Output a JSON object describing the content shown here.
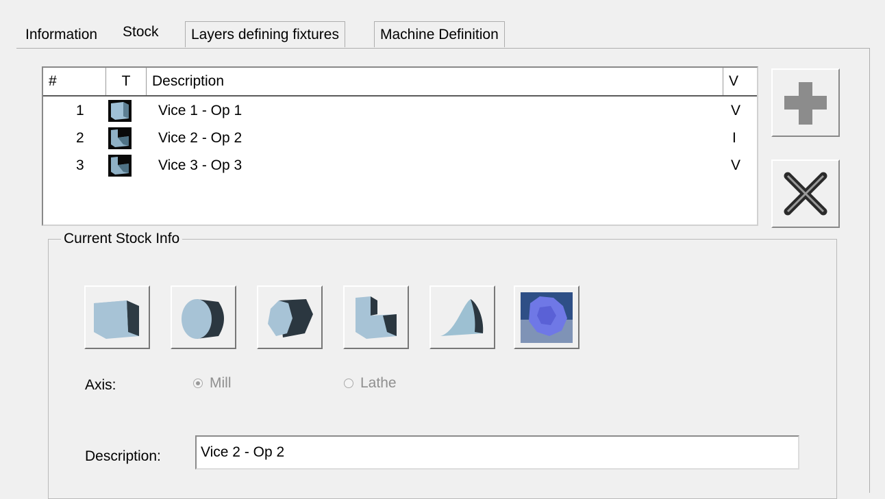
{
  "tabs": [
    {
      "label": "Information"
    },
    {
      "label": "Stock",
      "active": true
    },
    {
      "label": "Layers defining fixtures"
    },
    {
      "label": "Machine Definition"
    }
  ],
  "stock_list": {
    "columns": [
      "#",
      "T",
      "Description",
      "V"
    ],
    "rows": [
      {
        "num": "1",
        "type_icon": "block-stock-icon",
        "description": "Vice 1 - Op 1",
        "v": "V"
      },
      {
        "num": "2",
        "type_icon": "extrusion-stock-icon",
        "description": "Vice 2 - Op 2",
        "v": "I"
      },
      {
        "num": "3",
        "type_icon": "extrusion-stock-icon",
        "description": "Vice 3 - Op 3",
        "v": "V"
      }
    ]
  },
  "side_buttons": {
    "add_icon": "plus-icon",
    "delete_icon": "x-icon"
  },
  "current_stock": {
    "group_label": "Current Stock Info",
    "shape_buttons": [
      "block-icon",
      "cylinder-icon",
      "polygon-icon",
      "extrusion-icon",
      "revolve-icon",
      "mesh-icon"
    ],
    "axis_label": "Axis:",
    "axis_options": [
      {
        "label": "Mill",
        "checked": true
      },
      {
        "label": "Lathe",
        "checked": false
      }
    ],
    "description_label": "Description:",
    "description_value": "Vice 2 - Op 2"
  }
}
